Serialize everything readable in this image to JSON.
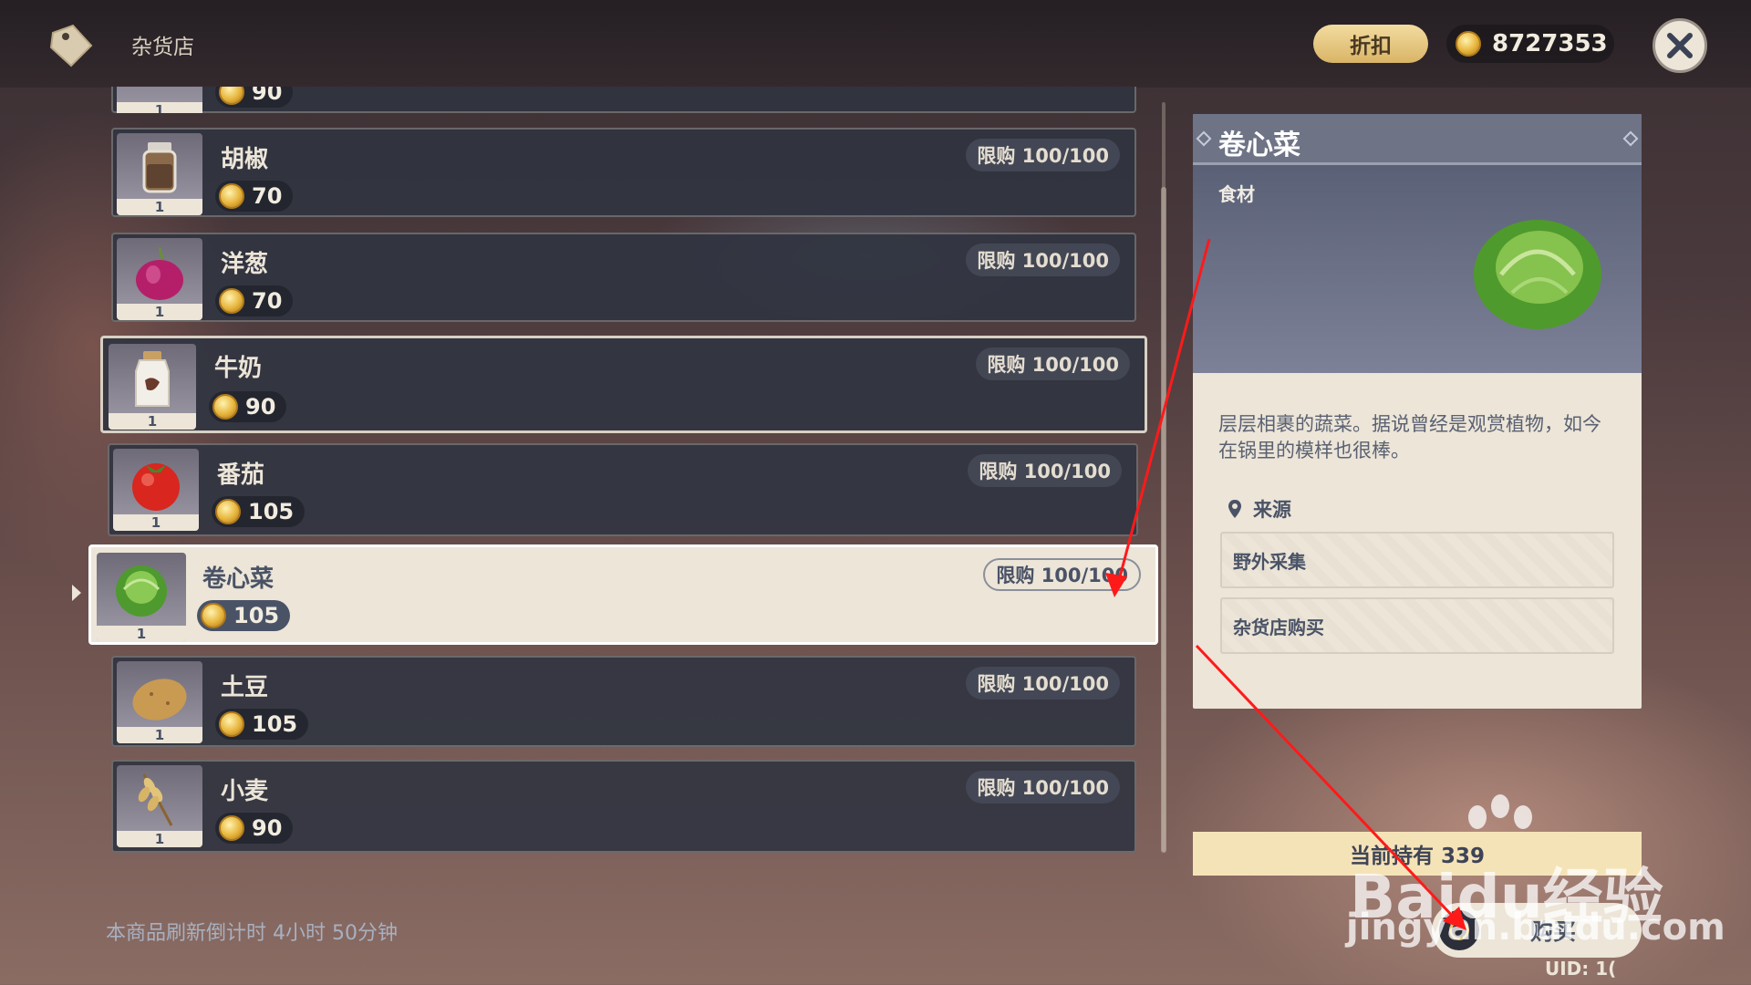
{
  "header": {
    "shop_title": "杂货店",
    "discount_label": "折扣",
    "coins": "8727353",
    "close_icon": "close-icon"
  },
  "items": [
    {
      "name": "",
      "price": "90",
      "limit": "",
      "qty": "1",
      "icon": "partial-item-icon",
      "state": "cut"
    },
    {
      "name": "胡椒",
      "price": "70",
      "limit": "限购 100/100",
      "qty": "1",
      "icon": "pepper-icon",
      "state": "normal"
    },
    {
      "name": "洋葱",
      "price": "70",
      "limit": "限购 100/100",
      "qty": "1",
      "icon": "onion-icon",
      "state": "normal"
    },
    {
      "name": "牛奶",
      "price": "90",
      "limit": "限购 100/100",
      "qty": "1",
      "icon": "milk-icon",
      "state": "hover"
    },
    {
      "name": "番茄",
      "price": "105",
      "limit": "限购 100/100",
      "qty": "1",
      "icon": "tomato-icon",
      "state": "normal"
    },
    {
      "name": "卷心菜",
      "price": "105",
      "limit": "限购 100/100",
      "qty": "1",
      "icon": "cabbage-icon",
      "state": "selected"
    },
    {
      "name": "土豆",
      "price": "105",
      "limit": "限购 100/100",
      "qty": "1",
      "icon": "potato-icon",
      "state": "normal"
    },
    {
      "name": "小麦",
      "price": "90",
      "limit": "限购 100/100",
      "qty": "1",
      "icon": "wheat-icon",
      "state": "normal"
    }
  ],
  "refresh_text": "本商品刷新倒计时 4小时 50分钟",
  "detail": {
    "title": "卷心菜",
    "category": "食材",
    "description": "层层相裹的蔬菜。据说曾经是观赏植物，如今在锅里的模样也很棒。",
    "source_title": "来源",
    "sources": [
      "野外采集",
      "杂货店购买"
    ],
    "owned": "当前持有 339",
    "buy_label": "购买",
    "uid": "UID: 1("
  },
  "watermark": {
    "line1": "Baidu经验",
    "line2": "jingyan.baidu.com"
  },
  "colors": {
    "row_bg": "#303440",
    "selected_bg": "#ece5d8",
    "panel_header": "#6e7386",
    "annotation_arrow": "#ff1a1a",
    "gold": "#e7b53c"
  }
}
